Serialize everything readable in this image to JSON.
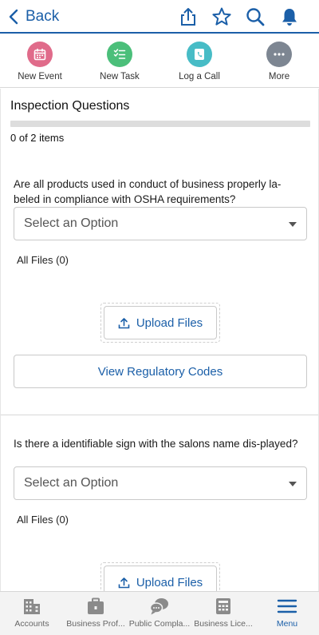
{
  "nav": {
    "back_label": "Back"
  },
  "actions": [
    {
      "label": "New Event",
      "icon": "calendar-icon",
      "color": "#e06b8a"
    },
    {
      "label": "New Task",
      "icon": "task-icon",
      "color": "#4bbf7a"
    },
    {
      "label": "Log a Call",
      "icon": "phone-icon",
      "color": "#47bcc6"
    },
    {
      "label": "More",
      "icon": "more-icon",
      "color": "#7d8692"
    }
  ],
  "inspection": {
    "title": "Inspection Questions",
    "count_text": "0 of 2 items",
    "progress": 0,
    "questions": [
      {
        "text": "Are all products used in conduct of business properly la-beled in compliance with OSHA requirements?",
        "select_placeholder": "Select an Option",
        "files_label": "All Files (0)",
        "upload_label": "Upload Files",
        "codes_label": "View Regulatory Codes"
      },
      {
        "text": "Is there a identifiable sign with the salons name dis-played?",
        "select_placeholder": "Select an Option",
        "files_label": "All Files (0)",
        "upload_label": "Upload Files"
      }
    ]
  },
  "tabs": [
    {
      "label": "Accounts",
      "icon": "building-icon"
    },
    {
      "label": "Business Prof...",
      "icon": "briefcase-icon"
    },
    {
      "label": "Public Compla...",
      "icon": "chat-icon"
    },
    {
      "label": "Business Lice...",
      "icon": "license-icon"
    },
    {
      "label": "Menu",
      "icon": "menu-icon",
      "active": true
    }
  ],
  "colors": {
    "brand": "#1b5fa8",
    "tab_icon": "#8a8a8a"
  }
}
